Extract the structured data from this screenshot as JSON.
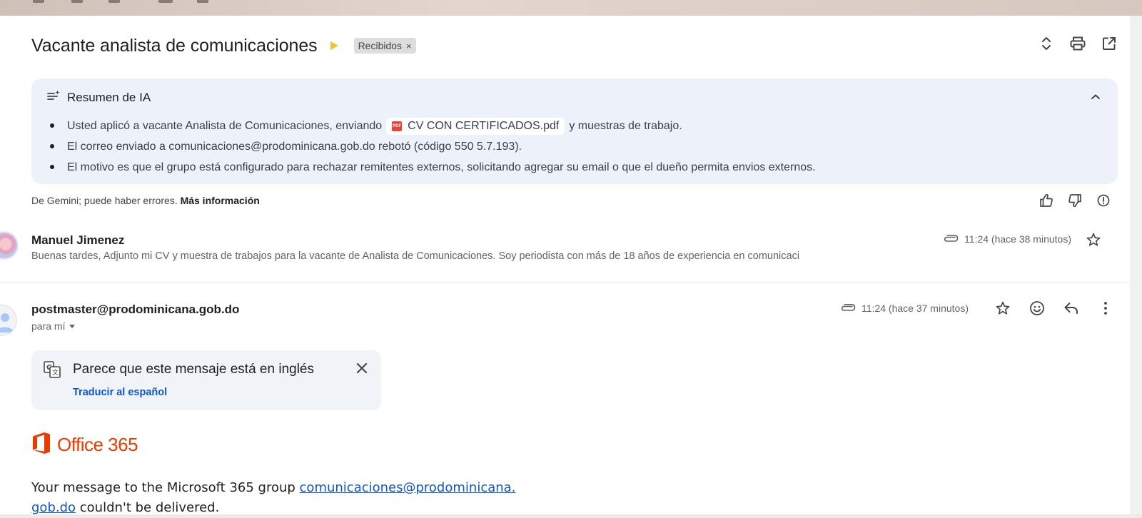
{
  "thread": {
    "subject": "Vacante analista de comunicaciones",
    "label": "Recibidos",
    "label_remove": "×"
  },
  "header_icons": [
    "expand-collapse-icon",
    "print-icon",
    "open-in-new-window-icon"
  ],
  "ai_summary": {
    "title": "Resumen de IA",
    "bullet1_pre": "Usted aplicó a vacante Analista de Comunicaciones, enviando",
    "bullet1_file": "CV CON CERTIFICADOS.pdf",
    "bullet1_post": "y muestras de trabajo.",
    "bullet2": "El correo enviado a comunicaciones@prodominicana.gob.do rebotó (código 550 5.7.193).",
    "bullet3": "El motivo es que el grupo está configurado para rechazar remitentes externos, solicitando agregar su email o que el dueño permita envios externos.",
    "disclaimer": "De Gemini; puede haber errores.",
    "more_info": "Más información",
    "pdf_badge": "PDF"
  },
  "messages": [
    {
      "sender": "Manuel Jimenez",
      "snippet": "Buenas tardes, Adjunto mi CV y muestra de trabajos para la vacante de Analista de Comunicaciones. Soy periodista con más de 18 años de experiencia en comunicaci",
      "time": "11:24 (hace 38 minutos)"
    },
    {
      "sender": "postmaster@prodominicana.gob.do",
      "recipient": "para mí",
      "time": "11:24 (hace 37 minutos)"
    }
  ],
  "translate": {
    "title": "Parece que este mensaje está en inglés",
    "action": "Traducir al español"
  },
  "office": {
    "wordmark": "Office 365"
  },
  "body": {
    "line1_pre": "Your message to the Microsoft 365 group ",
    "link_part1": "comunicaciones@prodominicana.",
    "link_part2": "gob.do",
    "line2_post": " couldn't be delivered."
  },
  "colors": {
    "importance": "#f6c026",
    "link": "#1155cc",
    "office_red": "#eb3c00",
    "ai_bg": "#edf2fa"
  }
}
